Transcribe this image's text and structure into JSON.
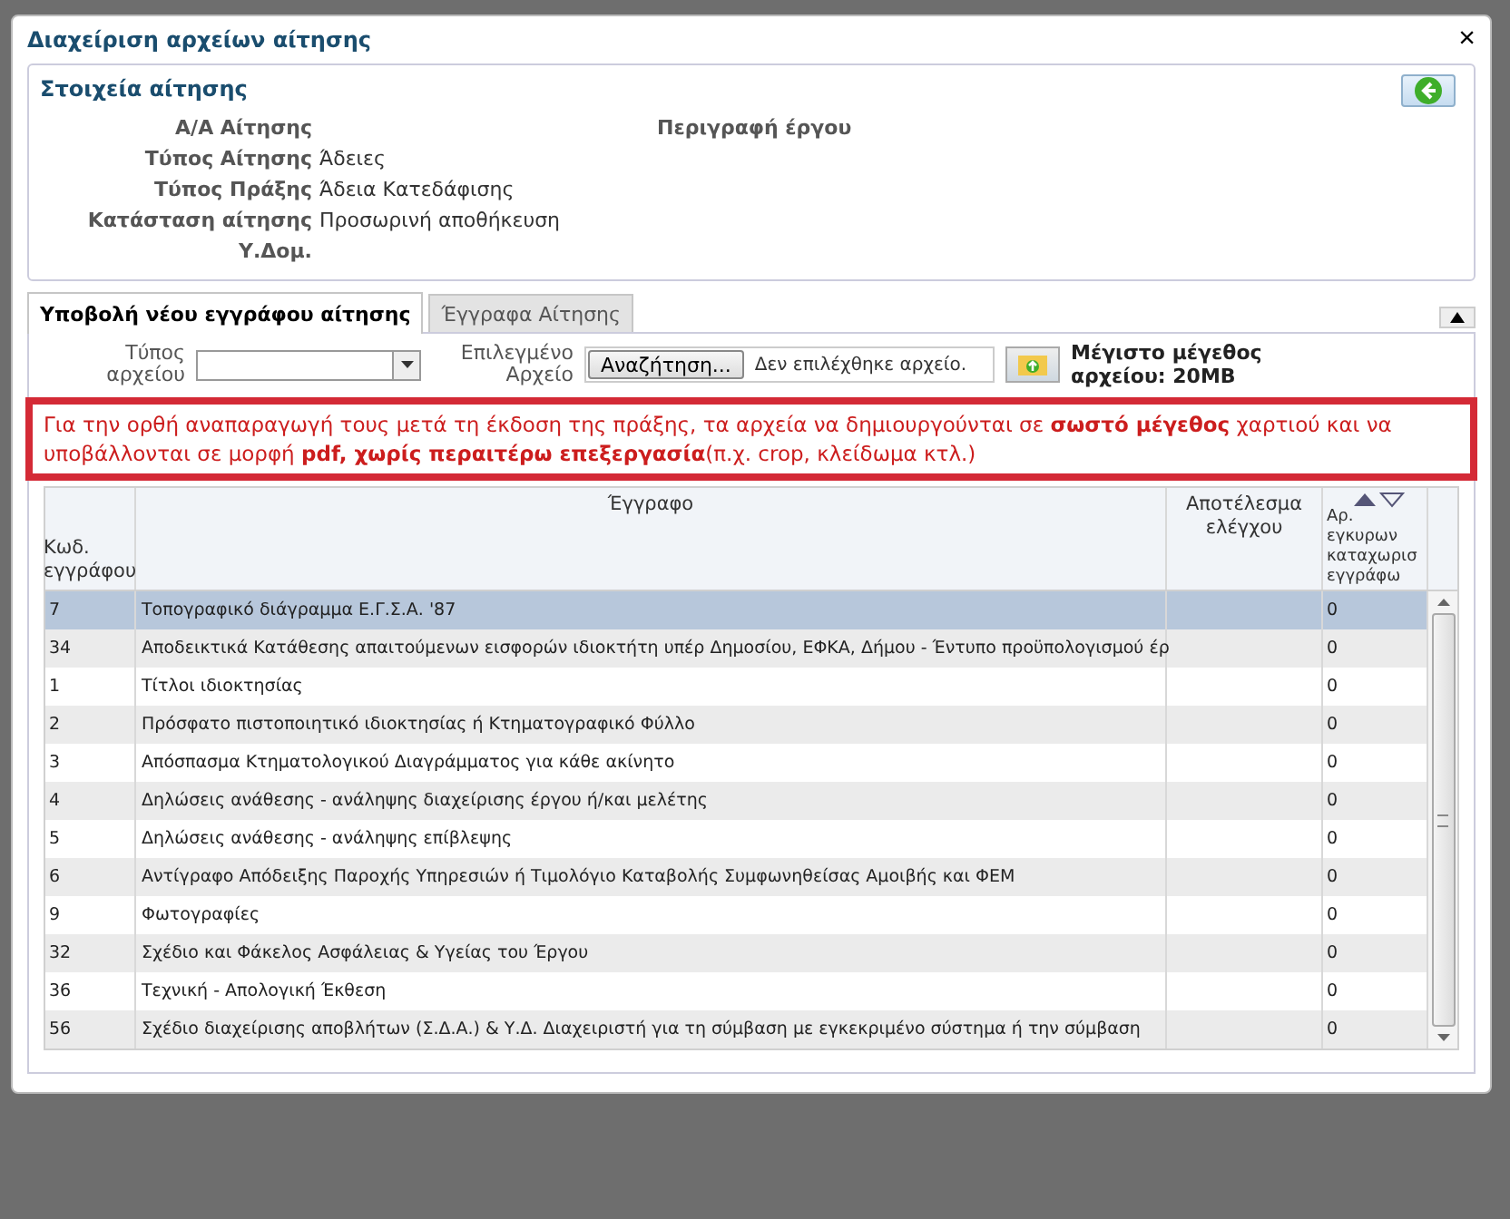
{
  "window": {
    "title": "Διαχείριση αρχείων αίτησης",
    "close": "×"
  },
  "info": {
    "title": "Στοιχεία αίτησης",
    "fields": [
      {
        "label": "Α/Α Αίτησης"
      },
      {
        "label": "Τύπος Αίτησης",
        "value": "Άδειες"
      },
      {
        "label": "Τύπος Πράξης",
        "value": "Άδεια Κατεδάφισης"
      },
      {
        "label": "Κατάσταση αίτησης",
        "value": "Προσωρινή αποθήκευση"
      },
      {
        "label": "Υ.Δομ."
      }
    ],
    "description_label": "Περιγραφή έργου"
  },
  "tabs": [
    {
      "label": "Υποβολή νέου εγγράφου αίτησης",
      "selected": true
    },
    {
      "label": "Έγγραφα Αίτησης",
      "selected": false
    }
  ],
  "form": {
    "type_label": "Τύπος αρχείου",
    "file_label": "Επιλεγμένο Αρχείο",
    "browse": "Αναζήτηση...",
    "no_file": "Δεν επιλέχθηκε αρχείο.",
    "max_size": "Μέγιστο μέγεθος αρχείου: 20MB"
  },
  "notice": "Για την ορθή αναπαραγωγή τους μετά τη έκδοση της πράξης, τα αρχεία να δημιουργούνται σε **σωστό μέγεθος** χαρτιού και να υποβάλλονται σε μορφή **pdf, χωρίς περαιτέρω επεξεργασία**(π.χ. crop, κλείδωμα κτλ.)",
  "table": {
    "columns": [
      "Κωδ. εγγράφου",
      "Έγγραφο",
      "Αποτέλεσμα ελέγχου",
      "Αρ. εγκυρων καταχωρισ εγγράφω"
    ],
    "rows": [
      {
        "code": "7",
        "document": "Τοπογραφικό διάγραμμα Ε.Γ.Σ.Α. '87",
        "result": "",
        "count": "0",
        "selected": true
      },
      {
        "code": "34",
        "document": "Αποδεικτικά Κατάθεσης απαιτούμενων εισφορών ιδιοκτήτη υπέρ Δημοσίου, ΕΦΚΑ, Δήμου - Έντυπο προϋπολογισμού έρ",
        "result": "",
        "count": "0",
        "selected": false
      },
      {
        "code": "1",
        "document": "Τίτλοι ιδιοκτησίας",
        "result": "",
        "count": "0",
        "selected": false
      },
      {
        "code": "2",
        "document": "Πρόσφατο πιστοποιητικό ιδιοκτησίας ή Κτηματογραφικό Φύλλο",
        "result": "",
        "count": "0",
        "selected": false
      },
      {
        "code": "3",
        "document": "Απόσπασμα Κτηματολογικού Διαγράμματος για κάθε ακίνητο",
        "result": "",
        "count": "0",
        "selected": false
      },
      {
        "code": "4",
        "document": "Δηλώσεις ανάθεσης - ανάληψης διαχείρισης έργου ή/και μελέτης",
        "result": "",
        "count": "0",
        "selected": false
      },
      {
        "code": "5",
        "document": "Δηλώσεις ανάθεσης - ανάληψης επίβλεψης",
        "result": "",
        "count": "0",
        "selected": false
      },
      {
        "code": "6",
        "document": "Αντίγραφο Απόδειξης Παροχής Υπηρεσιών ή Τιμολόγιο Καταβολής Συμφωνηθείσας Αμοιβής και ΦΕΜ",
        "result": "",
        "count": "0",
        "selected": false
      },
      {
        "code": "9",
        "document": "Φωτογραφίες",
        "result": "",
        "count": "0",
        "selected": false
      },
      {
        "code": "32",
        "document": "Σχέδιο και Φάκελος Ασφάλειας & Υγείας του Έργου",
        "result": "",
        "count": "0",
        "selected": false
      },
      {
        "code": "36",
        "document": "Τεχνική - Απολογική Έκθεση",
        "result": "",
        "count": "0",
        "selected": false
      },
      {
        "code": "56",
        "document": "Σχέδιο διαχείρισης αποβλήτων (Σ.Δ.Α.) & Υ.Δ. Διαχειριστή για τη σύμβαση με εγκεκριμένο σύστημα ή την σύμβαση",
        "result": "",
        "count": "0",
        "selected": false
      }
    ]
  }
}
